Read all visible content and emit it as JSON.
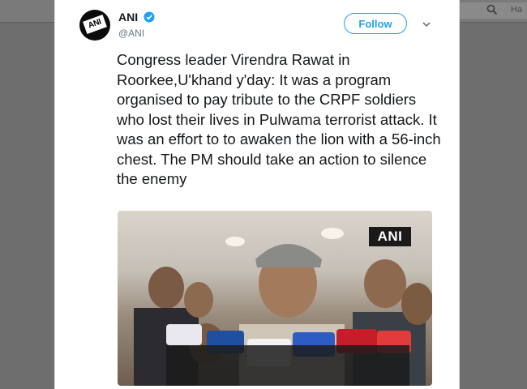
{
  "topbar": {
    "hint": "Ha"
  },
  "tweet": {
    "author": {
      "avatar_text": "ANI",
      "name": "ANI",
      "handle": "@ANI"
    },
    "follow_label": "Follow",
    "text": "Congress leader Virendra Rawat in Roorkee,U'khand y'day: It was a program organised to pay tribute to the CRPF soldiers who lost their lives in Pulwama terrorist attack. It was an effort to to awaken the lion with a 56-inch chest. The PM should take an action to silence the enemy",
    "media": {
      "watermark": "ANI"
    }
  },
  "colors": {
    "accent": "#1da1f2",
    "text": "#14171a",
    "muted": "#657786"
  },
  "icons": [
    "search-icon",
    "verified-icon",
    "chevron-down-icon"
  ]
}
